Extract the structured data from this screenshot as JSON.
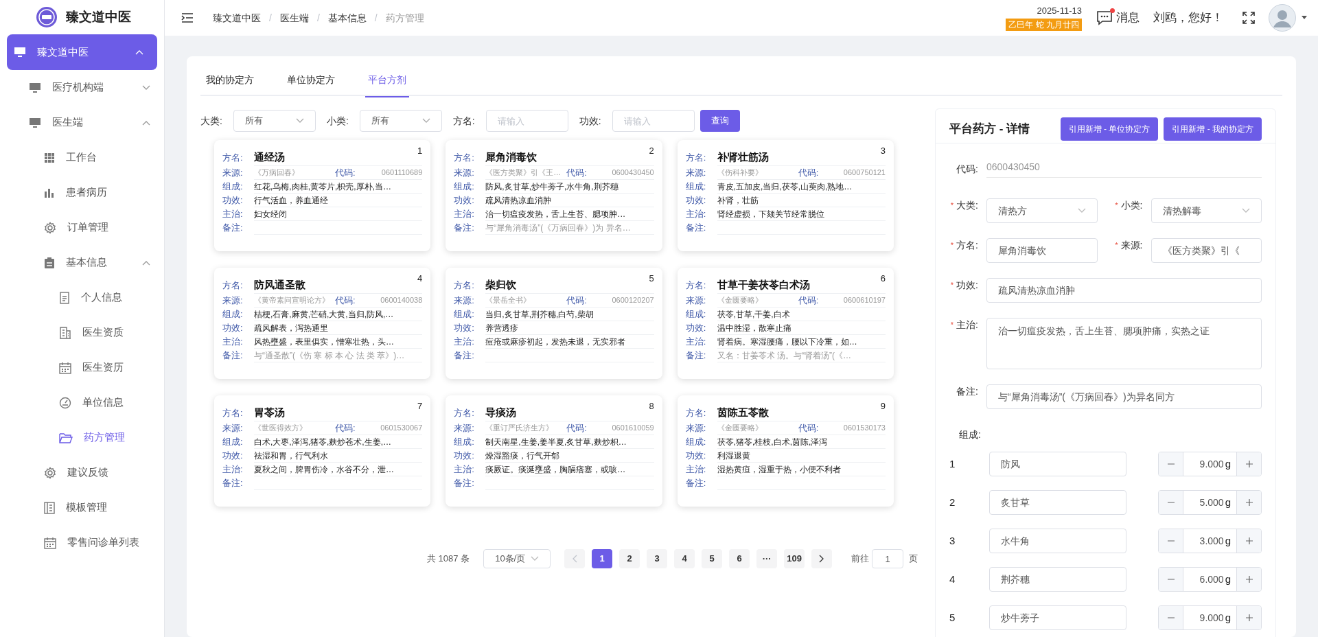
{
  "sidebar": {
    "brand": "臻文道中医",
    "menu": [
      {
        "label": "臻文道中医",
        "selected": true,
        "expanded": true,
        "children": [
          {
            "label": "医疗机构端",
            "selected": false,
            "expanded": false
          },
          {
            "label": "医生端",
            "selected": false,
            "expanded": true,
            "children": [
              {
                "label": "工作台",
                "selected": false
              },
              {
                "label": "患者病历",
                "selected": false
              },
              {
                "label": "订单管理",
                "selected": false
              },
              {
                "label": "基本信息",
                "selected": false,
                "expanded": true,
                "children": [
                  {
                    "label": "个人信息",
                    "selected": false
                  },
                  {
                    "label": "医生资质",
                    "selected": false
                  },
                  {
                    "label": "医生资历",
                    "selected": false
                  },
                  {
                    "label": "单位信息",
                    "selected": false
                  },
                  {
                    "label": "药方管理",
                    "selected": true
                  }
                ]
              },
              {
                "label": "建议反馈",
                "selected": false
              },
              {
                "label": "模板管理",
                "selected": false
              },
              {
                "label": "零售问诊单列表",
                "selected": false
              }
            ]
          }
        ]
      }
    ]
  },
  "header": {
    "breadcrumb_separator": "/",
    "breadcrumbs": [
      "臻文道中医",
      "医生端",
      "基本信息",
      "药方管理"
    ],
    "date": "2025-11-13",
    "lunar_date": "乙巳年 蛇 九月廿四",
    "messages": "消息",
    "unread": true,
    "greeting": "刘鸥，您好！"
  },
  "tabs": [
    {
      "label": "我的协定方",
      "selected": false
    },
    {
      "label": "单位协定方",
      "selected": false
    },
    {
      "label": "平台方剂",
      "selected": true
    }
  ],
  "filters": [
    {
      "kind": "select",
      "label": "大类:",
      "value": "所有"
    },
    {
      "kind": "select",
      "label": "小类:",
      "value": "所有"
    },
    {
      "kind": "input",
      "label": "方名:",
      "placeholder": "请输入"
    },
    {
      "kind": "input",
      "label": "功效:",
      "placeholder": "请输入"
    }
  ],
  "search_button": "查询",
  "cards": [
    {
      "number": "1",
      "fields": [
        {
          "kind": "name",
          "label": "方名:",
          "value": "通经汤"
        },
        {
          "kind": "source",
          "label": "来源:",
          "value": "《万病回春》",
          "code_label": "代码:",
          "code": "0601110689"
        },
        {
          "kind": "text",
          "label": "组成:",
          "value": "红花,乌梅,肉桂,黄芩片,枳壳,厚朴,当…"
        },
        {
          "kind": "text",
          "label": "功效:",
          "value": "行气活血，养血通经"
        },
        {
          "kind": "text",
          "label": "主治:",
          "value": "妇女经闭"
        },
        {
          "kind": "note",
          "label": "备注:"
        }
      ]
    },
    {
      "number": "2",
      "fields": [
        {
          "kind": "name",
          "label": "方名:",
          "value": "犀角消毒饮"
        },
        {
          "kind": "source",
          "label": "来源:",
          "value": "《医方类聚》引《王…",
          "code_label": "代码:",
          "code": "0600430450"
        },
        {
          "kind": "text",
          "label": "组成:",
          "value": "防风,炙甘草,炒牛蒡子,水牛角,荆芥穗"
        },
        {
          "kind": "text",
          "label": "功效:",
          "value": "疏风清热凉血消肿"
        },
        {
          "kind": "text",
          "label": "主治:",
          "value": "治一切瘟疫发热，舌上生苔、腮项肿…"
        },
        {
          "kind": "note",
          "label": "备注:",
          "value": "与“犀角消毒汤”(《万病回春》)为 异名…"
        }
      ]
    },
    {
      "number": "3",
      "fields": [
        {
          "kind": "name",
          "label": "方名:",
          "value": "补肾壮筋汤"
        },
        {
          "kind": "source",
          "label": "来源:",
          "value": "《伤科补要》",
          "code_label": "代码:",
          "code": "0600750121"
        },
        {
          "kind": "text",
          "label": "组成:",
          "value": "青皮,五加皮,当归,茯苓,山萸肉,熟地…"
        },
        {
          "kind": "text",
          "label": "功效:",
          "value": "补肾，壮筋"
        },
        {
          "kind": "text",
          "label": "主治:",
          "value": "肾经虚损，下颏关节经常脱位"
        },
        {
          "kind": "note",
          "label": "备注:"
        }
      ]
    },
    {
      "number": "4",
      "fields": [
        {
          "kind": "name",
          "label": "方名:",
          "value": "防风通圣散"
        },
        {
          "kind": "source",
          "label": "来源:",
          "value": "《黄帝素问宣明论方》",
          "code_label": "代码:",
          "code": "0600140038"
        },
        {
          "kind": "text",
          "label": "组成:",
          "value": "桔梗,石膏,麻黄,芒硝,大黄,当归,防风,…"
        },
        {
          "kind": "text",
          "label": "功效:",
          "value": "疏风解表，泻热通里"
        },
        {
          "kind": "text",
          "label": "主治:",
          "value": "风热壅盛，表里俱实，憎寒壮热，头…"
        },
        {
          "kind": "note",
          "label": "备注:",
          "value": "与“通圣散”(《伤 寒 标 本 心 法 类 萃》)…"
        }
      ]
    },
    {
      "number": "5",
      "fields": [
        {
          "kind": "name",
          "label": "方名:",
          "value": "柴归饮"
        },
        {
          "kind": "source",
          "label": "来源:",
          "value": "《景岳全书》",
          "code_label": "代码:",
          "code": "0600120207"
        },
        {
          "kind": "text",
          "label": "组成:",
          "value": "当归,炙甘草,荆芥穗,白芍,柴胡"
        },
        {
          "kind": "text",
          "label": "功效:",
          "value": "养营透疹"
        },
        {
          "kind": "text",
          "label": "主治:",
          "value": "痘疮或麻疹初起，发热未退，无实邪者"
        },
        {
          "kind": "note",
          "label": "备注:"
        }
      ]
    },
    {
      "number": "6",
      "fields": [
        {
          "kind": "name",
          "label": "方名:",
          "value": "甘草干姜茯苓白术汤"
        },
        {
          "kind": "source",
          "label": "来源:",
          "value": "《金匮要略》",
          "code_label": "代码:",
          "code": "0600610197"
        },
        {
          "kind": "text",
          "label": "组成:",
          "value": "茯苓,甘草,干姜,白术"
        },
        {
          "kind": "text",
          "label": "功效:",
          "value": "温中胜湿，散寒止痛"
        },
        {
          "kind": "text",
          "label": "主治:",
          "value": "肾着病。寒湿腰痛，腰以下冷重，如…"
        },
        {
          "kind": "note",
          "label": "备注:",
          "value": "又名：甘姜苓术 汤。与“肾着汤”(《…"
        }
      ]
    },
    {
      "number": "7",
      "fields": [
        {
          "kind": "name",
          "label": "方名:",
          "value": "胃苓汤"
        },
        {
          "kind": "source",
          "label": "来源:",
          "value": "《世医得效方》",
          "code_label": "代码:",
          "code": "0601530067"
        },
        {
          "kind": "text",
          "label": "组成:",
          "value": "白术,大枣,泽泻,猪苓,麸炒苍术,生姜,…"
        },
        {
          "kind": "text",
          "label": "功效:",
          "value": "祛湿和胃，行气利水"
        },
        {
          "kind": "text",
          "label": "主治:",
          "value": "夏秋之间，脾胃伤冷，水谷不分，泄…"
        },
        {
          "kind": "note",
          "label": "备注:"
        }
      ]
    },
    {
      "number": "8",
      "fields": [
        {
          "kind": "name",
          "label": "方名:",
          "value": "导痰汤"
        },
        {
          "kind": "source",
          "label": "来源:",
          "value": "《重订严氏济生方》",
          "code_label": "代码:",
          "code": "0601610059"
        },
        {
          "kind": "text",
          "label": "组成:",
          "value": "制天南星,生姜,姜半夏,炙甘草,麸炒枳…"
        },
        {
          "kind": "text",
          "label": "功效:",
          "value": "燥湿豁痰，行气开郁"
        },
        {
          "kind": "text",
          "label": "主治:",
          "value": "痰厥证。痰涎壅盛，胸膈痞塞，或咳…"
        },
        {
          "kind": "note",
          "label": "备注:"
        }
      ]
    },
    {
      "number": "9",
      "fields": [
        {
          "kind": "name",
          "label": "方名:",
          "value": "茵陈五苓散"
        },
        {
          "kind": "source",
          "label": "来源:",
          "value": "《金匮要略》",
          "code_label": "代码:",
          "code": "0601530173"
        },
        {
          "kind": "text",
          "label": "组成:",
          "value": "茯苓,猪苓,桂枝,白术,茵陈,泽泻"
        },
        {
          "kind": "text",
          "label": "功效:",
          "value": "利湿退黄"
        },
        {
          "kind": "text",
          "label": "主治:",
          "value": "湿热黄疸，湿重于热，小便不利者"
        },
        {
          "kind": "note",
          "label": "备注:"
        }
      ]
    }
  ],
  "pagination": {
    "total": "共 1087 条",
    "page_size": "10条/页",
    "pages": [
      {
        "label": "1",
        "selected": true
      },
      {
        "label": "2",
        "selected": false
      },
      {
        "label": "3",
        "selected": false
      },
      {
        "label": "4",
        "selected": false
      },
      {
        "label": "5",
        "selected": false
      },
      {
        "label": "6",
        "selected": false
      },
      {
        "label": "···",
        "selected": false
      },
      {
        "label": "109",
        "selected": false
      }
    ],
    "goto_label": "前往",
    "goto_value": "1",
    "goto_suffix": "页"
  },
  "detail": {
    "title": "平台药方 - 详情",
    "buttons": [
      "引用新增 - 单位协定方",
      "引用新增 - 我的协定方"
    ],
    "code": {
      "label": "代码:",
      "value": "0600430450"
    },
    "rows": [
      [
        {
          "kind": "select",
          "label": "大类:",
          "required_mark": "*",
          "value": "清热方"
        },
        {
          "kind": "select",
          "label": "小类:",
          "required_mark": "*",
          "value": "清热解毒"
        }
      ],
      [
        {
          "kind": "input",
          "label": "方名:",
          "required_mark": "*",
          "value": "犀角消毒饮"
        },
        {
          "kind": "input",
          "label": "来源:",
          "required_mark": "*",
          "value": "《医方类聚》引《"
        }
      ],
      [
        {
          "kind": "input",
          "label": "功效:",
          "required_mark": "*",
          "value": "疏风清热凉血消肿"
        }
      ],
      [
        {
          "kind": "textarea",
          "label": "主治:",
          "required_mark": "*",
          "value": "治一切瘟疫发热，舌上生苔、腮项肿痛，实热之证"
        }
      ],
      [
        {
          "kind": "input",
          "label": "备注:",
          "value": "与“犀角消毒汤”(《万病回春》)为异名同方"
        }
      ]
    ],
    "composition_label": "组成:",
    "ingredients": [
      {
        "number": "1",
        "name": "防风",
        "amount": "9.000",
        "unit": "g"
      },
      {
        "number": "2",
        "name": "炙甘草",
        "amount": "5.000",
        "unit": "g"
      },
      {
        "number": "3",
        "name": "水牛角",
        "amount": "3.000",
        "unit": "g"
      },
      {
        "number": "4",
        "name": "荆芥穗",
        "amount": "6.000",
        "unit": "g"
      },
      {
        "number": "5",
        "name": "炒牛蒡子",
        "amount": "9.000",
        "unit": "g"
      }
    ]
  }
}
